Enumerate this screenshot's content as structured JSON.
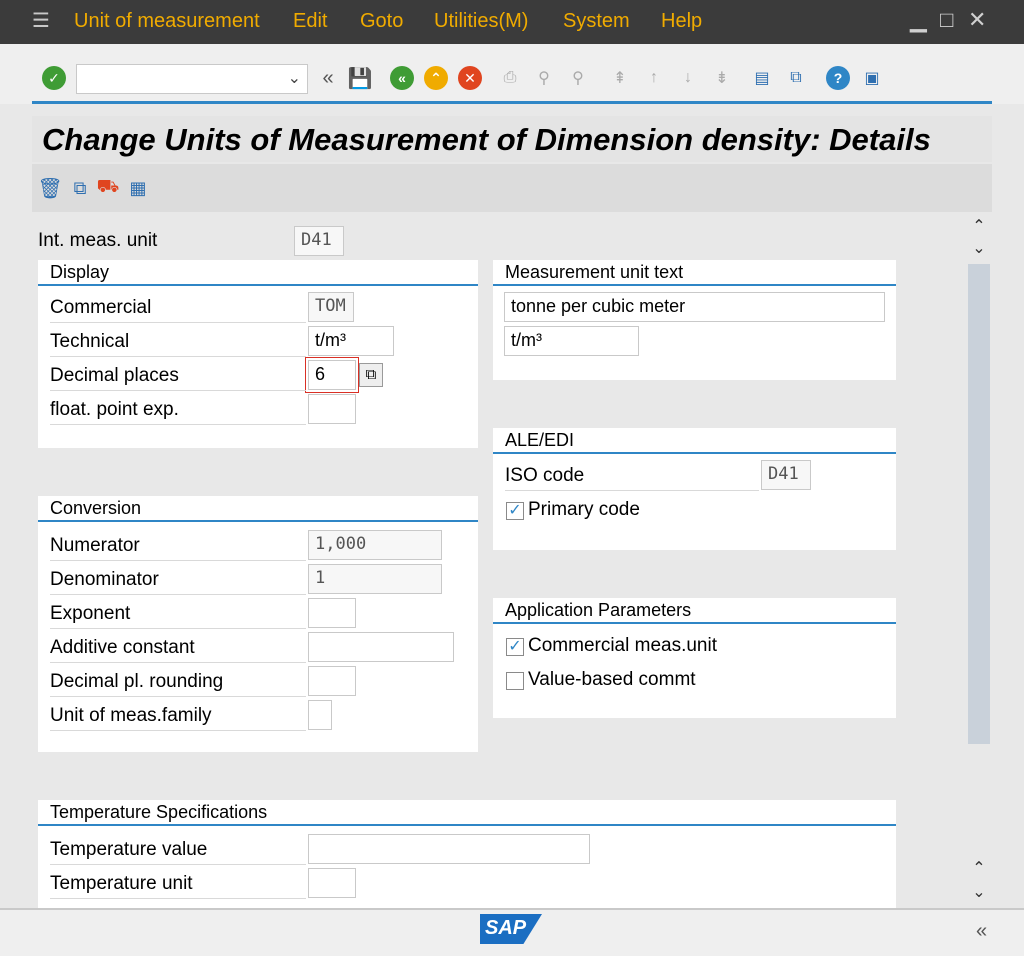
{
  "menu": {
    "items": [
      "Unit of measurement",
      "Edit",
      "Goto",
      "Utilities(M)",
      "System",
      "Help"
    ]
  },
  "toolbar": {
    "command_field_value": "",
    "icons": [
      "enter-check-icon",
      "command-dropdown-icon",
      "collapse-icon",
      "save-icon",
      "back-icon",
      "exit-icon",
      "cancel-icon",
      "print-icon",
      "find-icon",
      "find-next-icon",
      "first-page-icon",
      "previous-page-icon",
      "next-page-icon",
      "last-page-icon",
      "new-session-icon",
      "shortcut-icon",
      "help-icon",
      "customize-layout-icon"
    ]
  },
  "title": "Change Units of Measurement of Dimension density: Details",
  "app_toolbar": {
    "icons": [
      "delete-icon",
      "copy-icon",
      "transport-icon",
      "select-all-icon"
    ]
  },
  "int_meas_unit": {
    "label": "Int. meas. unit",
    "value": "D41"
  },
  "display": {
    "header": "Display",
    "commercial": {
      "label": "Commercial",
      "value": "TOM"
    },
    "technical": {
      "label": "Technical",
      "value": "t/m³"
    },
    "decimal_places": {
      "label": "Decimal places",
      "value": "6"
    },
    "float_point_exp": {
      "label": "float. point exp.",
      "value": ""
    }
  },
  "conversion": {
    "header": "Conversion",
    "numerator": {
      "label": "Numerator",
      "value": "1,000"
    },
    "denominator": {
      "label": "Denominator",
      "value": "1"
    },
    "exponent": {
      "label": "Exponent",
      "value": ""
    },
    "additive_constant": {
      "label": "Additive constant",
      "value": ""
    },
    "decimal_rounding": {
      "label": "Decimal pl. rounding",
      "value": ""
    },
    "unit_family": {
      "label": "Unit of meas.family",
      "value": ""
    }
  },
  "temperature": {
    "header": "Temperature Specifications",
    "value": {
      "label": "Temperature value",
      "value": ""
    },
    "unit": {
      "label": "Temperature unit",
      "value": ""
    }
  },
  "meas_unit_text": {
    "header": "Measurement unit text",
    "long_text": "tonne per cubic meter",
    "short_text": "t/m³"
  },
  "ale_edi": {
    "header": "ALE/EDI",
    "iso_code": {
      "label": "ISO code",
      "value": "D41"
    },
    "primary_code": {
      "label": "Primary code",
      "checked": true
    }
  },
  "app_params": {
    "header": "Application Parameters",
    "commercial_unit": {
      "label": "Commercial meas.unit",
      "checked": true
    },
    "value_based": {
      "label": "Value-based commt",
      "checked": false
    }
  },
  "footer": {
    "logo": "SAP"
  },
  "colors": {
    "accent": "#2f86c6",
    "menu_text": "#f0ab00",
    "menu_bg": "#3b3b3b"
  }
}
